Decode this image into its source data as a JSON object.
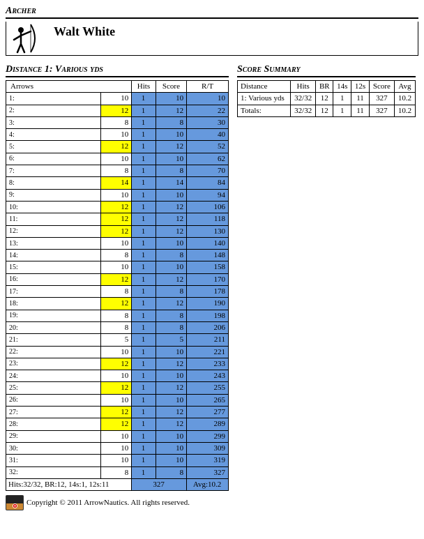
{
  "archer": {
    "section_label": "Archer",
    "name": "Walt White"
  },
  "distance": {
    "title": "Distance 1: Various yds",
    "headers": {
      "arrows": "Arrows",
      "hits": "Hits",
      "score": "Score",
      "rt": "R/T"
    },
    "rows": [
      {
        "n": "1:",
        "val": "10",
        "hi": false,
        "hits": "1",
        "score": "10",
        "rt": "10"
      },
      {
        "n": "2:",
        "val": "12",
        "hi": true,
        "hits": "1",
        "score": "12",
        "rt": "22"
      },
      {
        "n": "3:",
        "val": "8",
        "hi": false,
        "hits": "1",
        "score": "8",
        "rt": "30"
      },
      {
        "n": "4:",
        "val": "10",
        "hi": false,
        "hits": "1",
        "score": "10",
        "rt": "40"
      },
      {
        "n": "5:",
        "val": "12",
        "hi": true,
        "hits": "1",
        "score": "12",
        "rt": "52"
      },
      {
        "n": "6:",
        "val": "10",
        "hi": false,
        "hits": "1",
        "score": "10",
        "rt": "62"
      },
      {
        "n": "7:",
        "val": "8",
        "hi": false,
        "hits": "1",
        "score": "8",
        "rt": "70"
      },
      {
        "n": "8:",
        "val": "14",
        "hi": true,
        "hits": "1",
        "score": "14",
        "rt": "84"
      },
      {
        "n": "9:",
        "val": "10",
        "hi": false,
        "hits": "1",
        "score": "10",
        "rt": "94"
      },
      {
        "n": "10:",
        "val": "12",
        "hi": true,
        "hits": "1",
        "score": "12",
        "rt": "106"
      },
      {
        "n": "11:",
        "val": "12",
        "hi": true,
        "hits": "1",
        "score": "12",
        "rt": "118"
      },
      {
        "n": "12:",
        "val": "12",
        "hi": true,
        "hits": "1",
        "score": "12",
        "rt": "130"
      },
      {
        "n": "13:",
        "val": "10",
        "hi": false,
        "hits": "1",
        "score": "10",
        "rt": "140"
      },
      {
        "n": "14:",
        "val": "8",
        "hi": false,
        "hits": "1",
        "score": "8",
        "rt": "148"
      },
      {
        "n": "15:",
        "val": "10",
        "hi": false,
        "hits": "1",
        "score": "10",
        "rt": "158"
      },
      {
        "n": "16:",
        "val": "12",
        "hi": true,
        "hits": "1",
        "score": "12",
        "rt": "170"
      },
      {
        "n": "17:",
        "val": "8",
        "hi": false,
        "hits": "1",
        "score": "8",
        "rt": "178"
      },
      {
        "n": "18:",
        "val": "12",
        "hi": true,
        "hits": "1",
        "score": "12",
        "rt": "190"
      },
      {
        "n": "19:",
        "val": "8",
        "hi": false,
        "hits": "1",
        "score": "8",
        "rt": "198"
      },
      {
        "n": "20:",
        "val": "8",
        "hi": false,
        "hits": "1",
        "score": "8",
        "rt": "206"
      },
      {
        "n": "21:",
        "val": "5",
        "hi": false,
        "hits": "1",
        "score": "5",
        "rt": "211"
      },
      {
        "n": "22:",
        "val": "10",
        "hi": false,
        "hits": "1",
        "score": "10",
        "rt": "221"
      },
      {
        "n": "23:",
        "val": "12",
        "hi": true,
        "hits": "1",
        "score": "12",
        "rt": "233"
      },
      {
        "n": "24:",
        "val": "10",
        "hi": false,
        "hits": "1",
        "score": "10",
        "rt": "243"
      },
      {
        "n": "25:",
        "val": "12",
        "hi": true,
        "hits": "1",
        "score": "12",
        "rt": "255"
      },
      {
        "n": "26:",
        "val": "10",
        "hi": false,
        "hits": "1",
        "score": "10",
        "rt": "265"
      },
      {
        "n": "27:",
        "val": "12",
        "hi": true,
        "hits": "1",
        "score": "12",
        "rt": "277"
      },
      {
        "n": "28:",
        "val": "12",
        "hi": true,
        "hits": "1",
        "score": "12",
        "rt": "289"
      },
      {
        "n": "29:",
        "val": "10",
        "hi": false,
        "hits": "1",
        "score": "10",
        "rt": "299"
      },
      {
        "n": "30:",
        "val": "10",
        "hi": false,
        "hits": "1",
        "score": "10",
        "rt": "309"
      },
      {
        "n": "31:",
        "val": "10",
        "hi": false,
        "hits": "1",
        "score": "10",
        "rt": "319"
      },
      {
        "n": "32:",
        "val": "8",
        "hi": false,
        "hits": "1",
        "score": "8",
        "rt": "327"
      }
    ],
    "footer": {
      "stats": "Hits:32/32, BR:12, 14s:1, 12s:11",
      "total_score": "327",
      "avg": "Avg:10.2"
    }
  },
  "summary": {
    "title": "Score Summary",
    "headers": {
      "distance": "Distance",
      "hits": "Hits",
      "br": "BR",
      "s14": "14s",
      "s12": "12s",
      "score": "Score",
      "avg": "Avg"
    },
    "rows": [
      {
        "distance": "1: Various yds",
        "hits": "32/32",
        "br": "12",
        "s14": "1",
        "s12": "11",
        "score": "327",
        "avg": "10.2"
      },
      {
        "distance": "Totals:",
        "hits": "32/32",
        "br": "12",
        "s14": "1",
        "s12": "11",
        "score": "327",
        "avg": "10.2"
      }
    ]
  },
  "copyright": "Copyright © 2011 ArrowNautics. All rights reserved."
}
